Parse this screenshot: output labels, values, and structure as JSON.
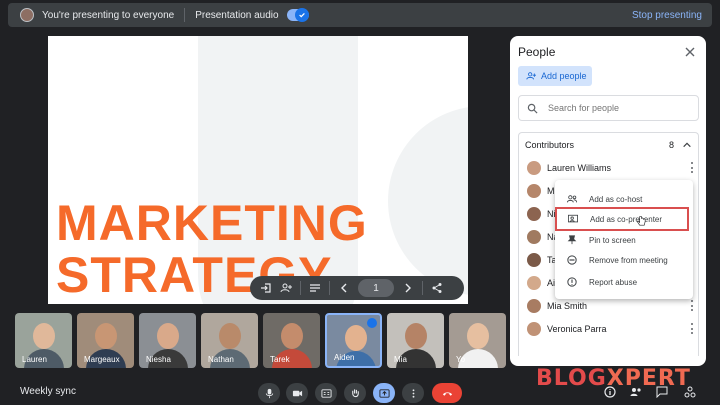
{
  "topbar": {
    "presenting_text": "You're presenting to everyone",
    "audio_label": "Presentation audio",
    "audio_on": true,
    "stop_label": "Stop presenting"
  },
  "slide": {
    "line1": "MARKETING",
    "line2": "STRATEGY",
    "page_number": "1",
    "accent_color": "#f56a2a"
  },
  "thumbnails": [
    {
      "name": "Lauren"
    },
    {
      "name": "Margeaux"
    },
    {
      "name": "Niesha"
    },
    {
      "name": "Nathan"
    },
    {
      "name": "Tarek"
    },
    {
      "name": "Aiden"
    },
    {
      "name": "Mia"
    },
    {
      "name": "Yo"
    }
  ],
  "panel": {
    "title": "People",
    "add_people_label": "Add people",
    "search_placeholder": "Search for people",
    "contributors_label": "Contributors",
    "contributors_count": "8",
    "people": [
      {
        "name": "Lauren Williams"
      },
      {
        "name": "M"
      },
      {
        "name": "Ni"
      },
      {
        "name": "Na"
      },
      {
        "name": "Ta"
      },
      {
        "name": "Ai"
      },
      {
        "name": "Mia Smith"
      },
      {
        "name": "Veronica Parra"
      }
    ]
  },
  "menu": {
    "items": [
      {
        "label": "Add as co-host",
        "icon": "group-icon"
      },
      {
        "label": "Add as co-presenter",
        "icon": "present-person-icon"
      },
      {
        "label": "Pin to screen",
        "icon": "pin-icon"
      },
      {
        "label": "Remove from meeting",
        "icon": "remove-circle-icon"
      },
      {
        "label": "Report abuse",
        "icon": "info-icon"
      }
    ]
  },
  "bottom": {
    "meeting_name": "Weekly sync"
  },
  "watermark": {
    "part1": "BLOG",
    "part2": "XPERT"
  }
}
